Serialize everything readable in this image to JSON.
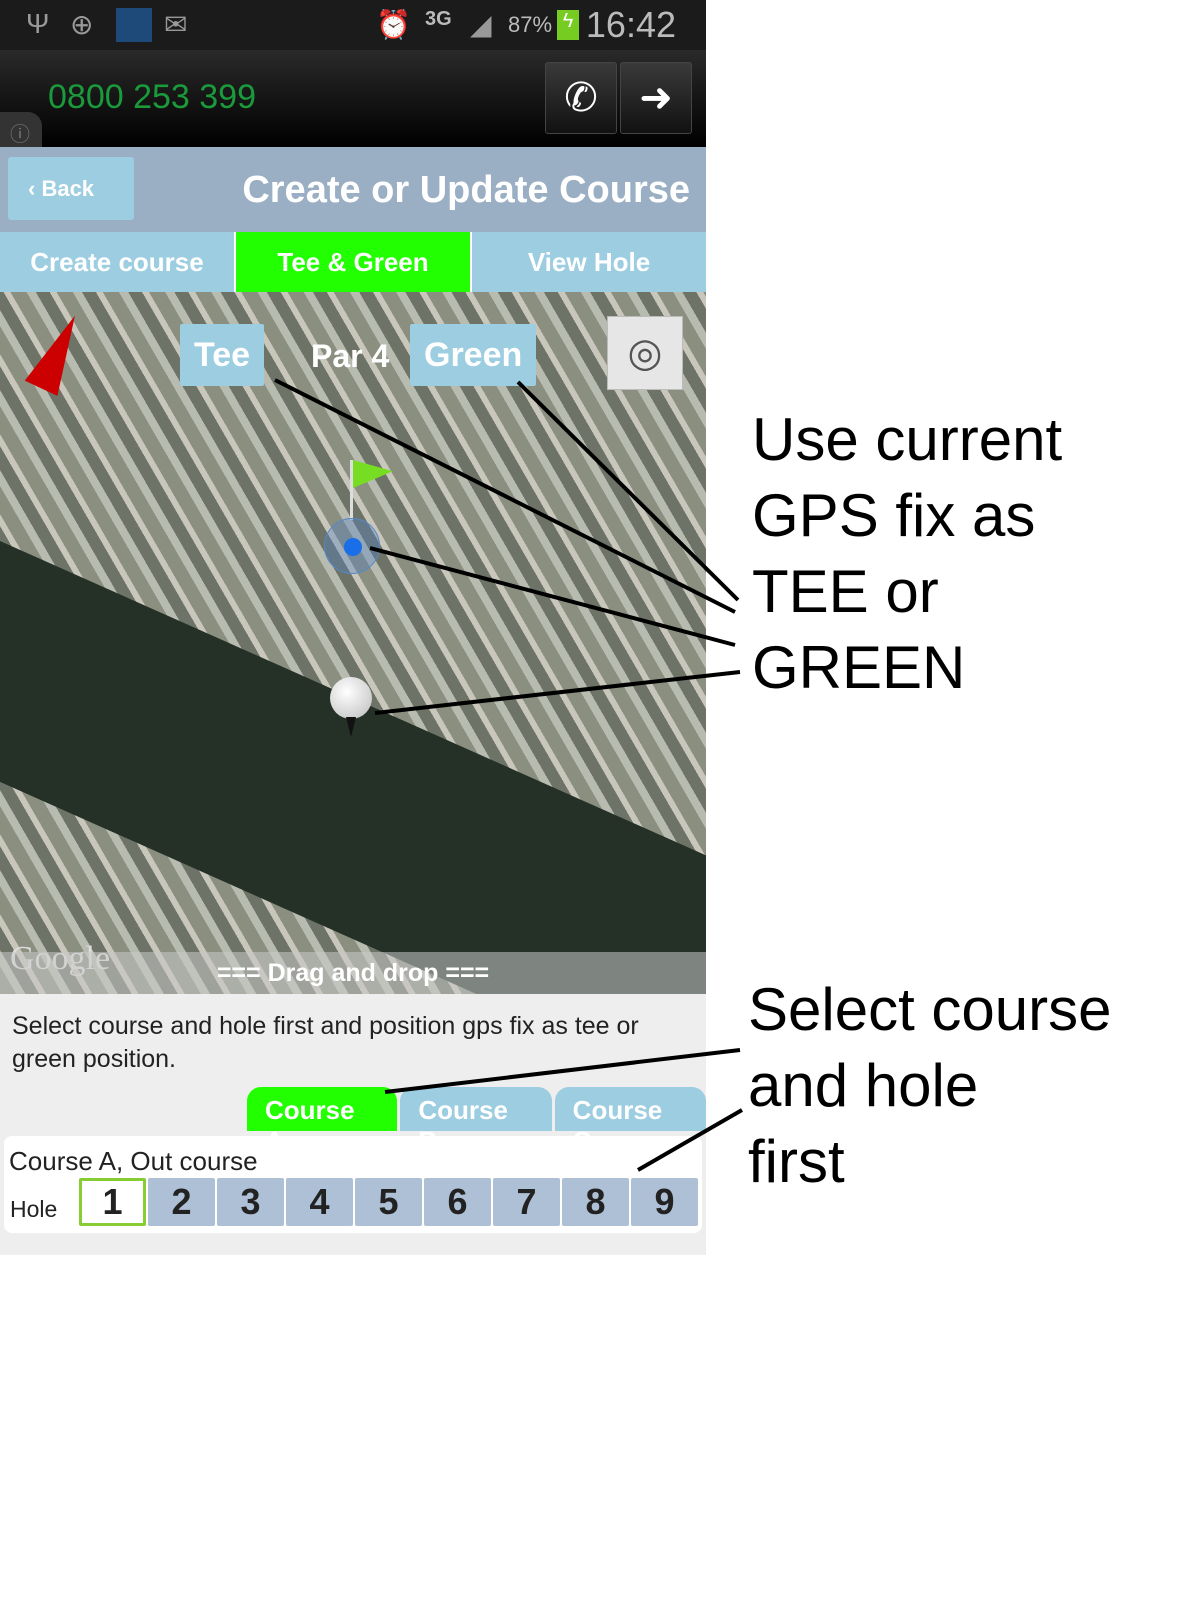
{
  "status_bar": {
    "network": "3G",
    "battery": "87%",
    "time": "16:42",
    "icons": [
      "usb-icon",
      "gps-icon",
      "wifi-icon",
      "mail-icon",
      "alarm-icon",
      "signal-icon",
      "battery-charging-icon"
    ]
  },
  "call_bar": {
    "phone_number": "0800 253 399",
    "call_icon": "phone-icon",
    "forward_icon": "arrow-right-icon",
    "info_icon": "info-icon"
  },
  "header": {
    "back_label": "Back",
    "title": "Create or Update Course"
  },
  "tabs": [
    {
      "label": "Create course",
      "active": false
    },
    {
      "label": "Tee & Green",
      "active": true
    },
    {
      "label": "View Hole",
      "active": false
    }
  ],
  "map": {
    "tee_label": "Tee",
    "par_label": "Par 4",
    "green_label": "Green",
    "attribution": "Google",
    "drag_hint": "=== Drag and drop ==="
  },
  "description": "Select course and hole first and position gps fix as tee or green position.",
  "course_tabs": [
    {
      "label": "Course A",
      "active": true
    },
    {
      "label": "Course B",
      "active": false
    },
    {
      "label": "Course C",
      "active": false
    }
  ],
  "course_panel": {
    "title": "Course A, Out course",
    "hole_label": "Hole",
    "holes": [
      "1",
      "2",
      "3",
      "4",
      "5",
      "6",
      "7",
      "8",
      "9"
    ],
    "selected_hole": "1"
  },
  "annotations": {
    "gps": [
      "Use current",
      "GPS fix as",
      "TEE or",
      "GREEN"
    ],
    "select": [
      "Select course",
      "and hole",
      "first"
    ]
  },
  "colors": {
    "active_tab": "#22ff00",
    "tab": "#9ccde0",
    "title_bar": "#9aafc4",
    "phone_number": "#1a9a3a"
  }
}
